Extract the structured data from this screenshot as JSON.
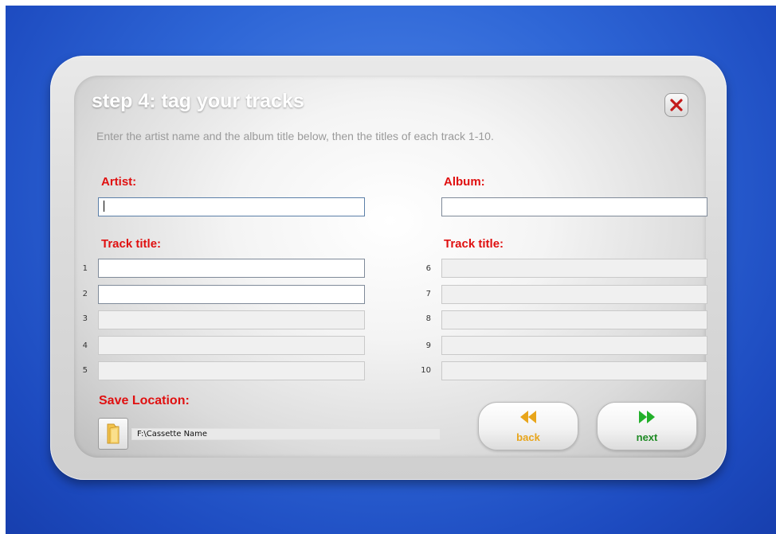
{
  "dialog": {
    "title": "step 4: tag your tracks",
    "subtitle": "Enter the artist name and the album title below, then the titles of each track 1-10."
  },
  "artist": {
    "label": "Artist:",
    "value": ""
  },
  "album": {
    "label": "Album:",
    "value": ""
  },
  "tracks_left": {
    "label": "Track title:",
    "items": [
      {
        "num": "1",
        "value": ""
      },
      {
        "num": "2",
        "value": ""
      },
      {
        "num": "3",
        "value": ""
      },
      {
        "num": "4",
        "value": ""
      },
      {
        "num": "5",
        "value": ""
      }
    ]
  },
  "tracks_right": {
    "label": "Track title:",
    "items": [
      {
        "num": "6",
        "value": ""
      },
      {
        "num": "7",
        "value": ""
      },
      {
        "num": "8",
        "value": ""
      },
      {
        "num": "9",
        "value": ""
      },
      {
        "num": "10",
        "value": ""
      }
    ]
  },
  "save": {
    "label": "Save Location:",
    "path": "F:\\Cassette Name",
    "folder_icon": "folder-icon"
  },
  "nav": {
    "back_label": "back",
    "next_label": "next",
    "back_icon": "rewind-icon",
    "next_icon": "fast-forward-icon"
  },
  "colors": {
    "label_red": "#e01010",
    "close_x": "#c41a1a",
    "back_accent": "#e8a51a",
    "next_accent": "#22b02a"
  }
}
